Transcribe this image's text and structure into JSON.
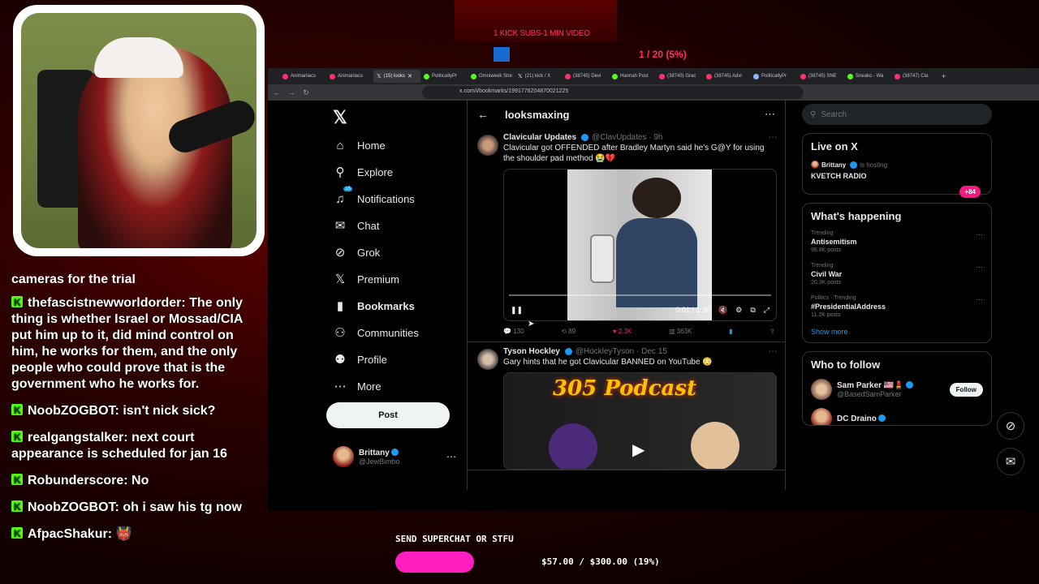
{
  "overlay": {
    "kick_subs": "1 KICK SUBS-1 MIN VIDEO",
    "top_progress": "1 / 20 (5%)",
    "superchat_prompt": "SEND SUPERCHAT OR STFU",
    "superchat_amount": "$57.00 / $300.00 (19%)",
    "superchat_progress": 0.19,
    "superchat_color": "#ff1fbf"
  },
  "chat": {
    "cut_line": "cameras for the trial",
    "messages": [
      {
        "user": "thefascistnewworldorder",
        "text": "The only thing is whether Israel or Mossad/CIA put him up to it, did mind control on him, he works for them, and the only people who could prove that is the government who he works for."
      },
      {
        "user": "NoobZOGBOT",
        "text": "isn't nick sick?"
      },
      {
        "user": "realgangstalker",
        "text": "next court appearance is scheduled for jan 16"
      },
      {
        "user": "Robunderscore",
        "text": "No"
      },
      {
        "user": "NoobZOGBOT",
        "text": "oh i saw his tg now"
      },
      {
        "user": "AfpacShakur",
        "text": "👹"
      }
    ]
  },
  "browser": {
    "tabs": [
      "Animaniacs",
      "Animaniacs",
      "(15) looks",
      "PoliticallyPr",
      "Omniweek Stre",
      "(21) kick / X",
      "(38745) Devi",
      "Hannah Post",
      "(38745) Grac",
      "(38745) Advi",
      "PoliticallyPr",
      "(38745) SNE",
      "Sneako - Wa",
      "(38747) Cla"
    ],
    "active_tab_index": 2,
    "url": "x.com/i/bookmarks/1991776204870021225"
  },
  "x": {
    "nav": [
      {
        "label": "Home",
        "icon": "home-icon",
        "glyph": "⌂"
      },
      {
        "label": "Explore",
        "icon": "search-icon",
        "glyph": "⚲"
      },
      {
        "label": "Notifications",
        "icon": "bell-icon",
        "glyph": "🔔",
        "badge": "15"
      },
      {
        "label": "Chat",
        "icon": "chat-icon",
        "glyph": "✉"
      },
      {
        "label": "Grok",
        "icon": "grok-icon",
        "glyph": "⊘"
      },
      {
        "label": "Premium",
        "icon": "x-premium-icon",
        "glyph": "𝕏"
      },
      {
        "label": "Bookmarks",
        "icon": "bookmark-icon",
        "glyph": "▮",
        "active": true
      },
      {
        "label": "Communities",
        "icon": "communities-icon",
        "glyph": "⚇"
      },
      {
        "label": "Profile",
        "icon": "profile-icon",
        "glyph": "⚉"
      },
      {
        "label": "More",
        "icon": "more-icon",
        "glyph": "⋯"
      }
    ],
    "post_label": "Post",
    "account": {
      "name": "Brittany",
      "handle": "@JewBimbo"
    },
    "header_title": "looksmaxing",
    "tweets": [
      {
        "name": "Clavicular Updates",
        "handle": "@ClavUpdates · 9h",
        "text": "Clavicular got OFFENDED after Bradley Martyn said he's G@Y for using the shoulder pad method 😭💔",
        "video_time": "0:01 / 1:36",
        "replies": "130",
        "reposts": "89",
        "likes": "2.3K",
        "views": "363K"
      },
      {
        "name": "Tyson Hockley",
        "handle": "@HockleyTyson · Dec 15",
        "text": "Gary hints that he got Clavicular BANNED on YouTube 😳",
        "media_text": "305 Podcast"
      }
    ],
    "search_placeholder": "Search",
    "live": {
      "title": "Live on X",
      "host": "Brittany",
      "host_suffix": "is hosting",
      "show": "KVETCH RADIO",
      "count": "+84"
    },
    "happening": {
      "title": "What's happening",
      "trends": [
        {
          "meta": "Trending",
          "topic": "Antisemitism",
          "posts": "98.8K posts"
        },
        {
          "meta": "Trending",
          "topic": "Civil War",
          "posts": "20.3K posts"
        },
        {
          "meta": "Politics · Trending",
          "topic": "#PresidentialAddress",
          "posts": "11.2K posts"
        }
      ],
      "show_more": "Show more"
    },
    "who_to_follow": {
      "title": "Who to follow",
      "users": [
        {
          "name": "Sam Parker 🇺🇸💄",
          "handle": "@BasedSamParker",
          "button": "Follow"
        },
        {
          "name": "DC Draino",
          "handle": "",
          "button": ""
        }
      ]
    }
  }
}
